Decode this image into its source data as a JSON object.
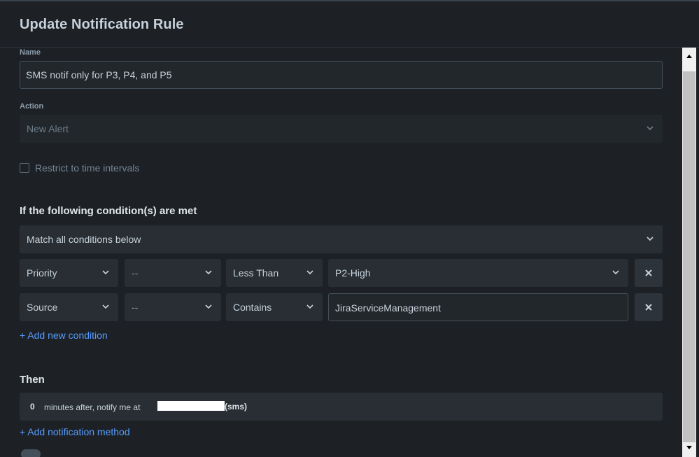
{
  "dialog": {
    "title": "Update Notification Rule"
  },
  "form": {
    "name_label": "Name",
    "name_value": "SMS notif only for P3, P4, and P5",
    "action_label": "Action",
    "action_value": "New Alert",
    "restrict_label": "Restrict to time intervals",
    "restrict_checked": false
  },
  "conditions": {
    "heading": "If the following condition(s) are met",
    "match_value": "Match all conditions below",
    "rows": [
      {
        "field": "Priority",
        "modifier": "--",
        "operator": "Less Than",
        "value": "P2-High",
        "value_type": "select"
      },
      {
        "field": "Source",
        "modifier": "--",
        "operator": "Contains",
        "value": "JiraServiceManagement",
        "value_type": "text"
      }
    ],
    "add_label": "+ Add new condition"
  },
  "then": {
    "heading": "Then",
    "delay": "0",
    "text": "minutes after, notify me at",
    "channel": "(sms)",
    "add_method_label": "+ Add notification method"
  },
  "icons": {
    "chevron": "chevron-down-icon",
    "remove": "close-icon",
    "scroll_up": "scroll-up-arrow-icon",
    "scroll_down": "scroll-down-arrow-icon"
  },
  "colors": {
    "background": "#1d2125",
    "field_background": "#282e33",
    "link": "#579dff",
    "text": "#c7d1db"
  }
}
